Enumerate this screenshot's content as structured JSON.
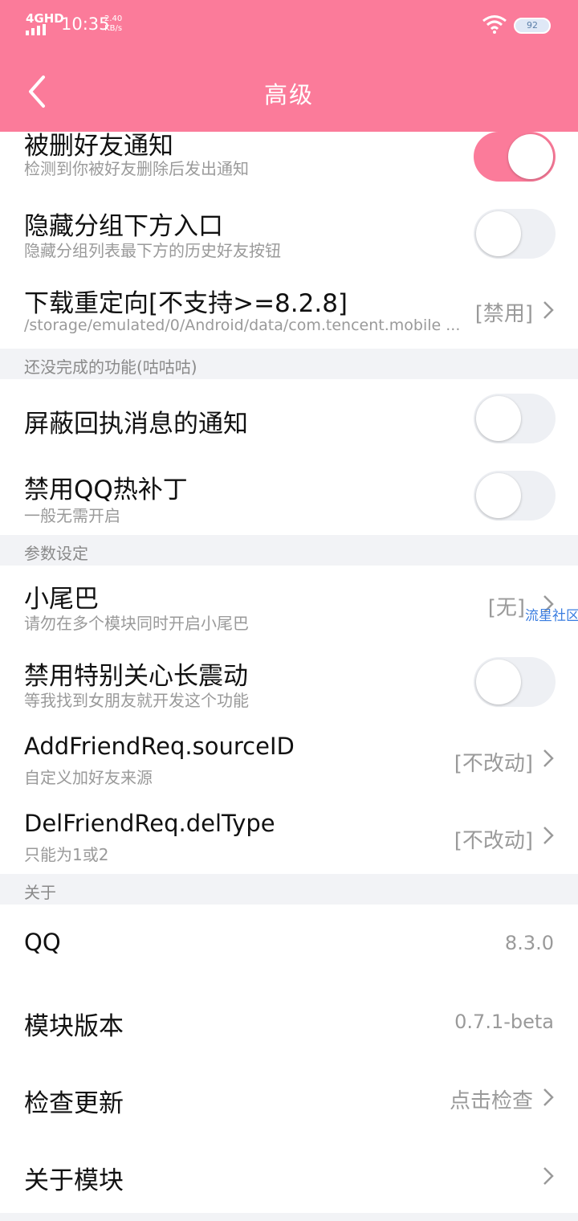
{
  "status_bar": {
    "network": "4GHD",
    "time": "10:35",
    "speed_value": "2.40",
    "speed_unit": "KB/s",
    "battery": "92"
  },
  "header": {
    "title": "高级"
  },
  "rows": {
    "deleted_friend_notice": {
      "label": "被删好友通知",
      "sub": "检测到你被好友删除后发出通知",
      "toggle_on": true
    },
    "hide_group_entry": {
      "label": "隐藏分组下方入口",
      "sub": "隐藏分组列表最下方的历史好友按钮",
      "toggle_on": false
    },
    "download_redirect": {
      "label": "下载重定向[不支持>=8.2.8]",
      "sub": "/storage/emulated/0/Android/data/com.tencent.mobile ...",
      "value": "[禁用]"
    },
    "block_receipt_notice": {
      "label": "屏蔽回执消息的通知",
      "toggle_on": false
    },
    "disable_hotpatch": {
      "label": "禁用QQ热补丁",
      "sub": "一般无需开启",
      "toggle_on": false
    },
    "tail": {
      "label": "小尾巴",
      "sub": "请勿在多个模块同时开启小尾巴",
      "value": "[无]",
      "overlay": "流星社区"
    },
    "disable_vibration": {
      "label": "禁用特别关心长震动",
      "sub": "等我找到女朋友就开发这个功能",
      "toggle_on": false
    },
    "add_friend_source": {
      "label": "AddFriendReq.sourceID",
      "sub": "自定义加好友来源",
      "value": "[不改动]"
    },
    "del_friend_type": {
      "label": "DelFriendReq.delType",
      "sub": "只能为1或2",
      "value": "[不改动]"
    },
    "qq_version": {
      "label": "QQ",
      "value": "8.3.0"
    },
    "module_version": {
      "label": "模块版本",
      "value": "0.7.1-beta"
    },
    "check_update": {
      "label": "检查更新",
      "value": "点击检查"
    },
    "about_module": {
      "label": "关于模块"
    }
  },
  "sections": {
    "unfinished": "还没完成的功能(咕咕咕)",
    "params": "参数设定",
    "about": "关于"
  },
  "colors": {
    "accent": "#fb7b9a",
    "section_bg": "#f2f3f6",
    "muted_text": "#9a9a9a"
  },
  "icons": {
    "back": "chevron-left-icon",
    "row_arrow": "chevron-right-icon",
    "wifi": "wifi-icon",
    "battery": "battery-icon"
  }
}
